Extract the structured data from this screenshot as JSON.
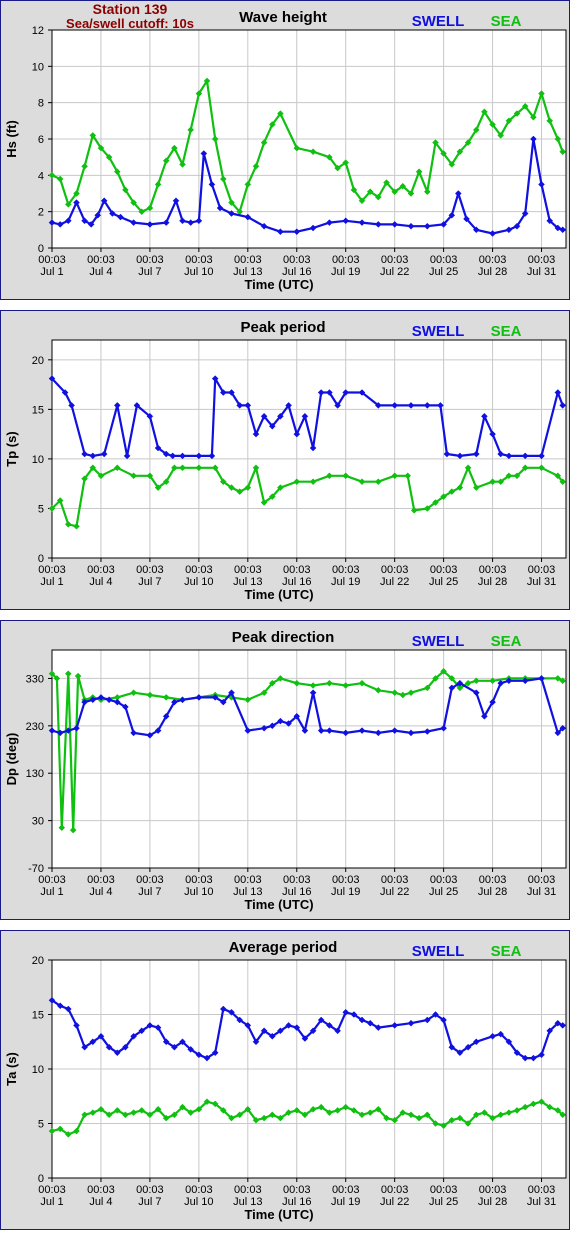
{
  "header": {
    "station": "Station 139",
    "cutoff": "Sea/swell cutoff: 10s"
  },
  "legend": {
    "swell": "SWELL",
    "sea": "SEA"
  },
  "colors": {
    "swell": "#1010e0",
    "sea": "#10c010",
    "panel_bg": "#dcdcdc",
    "border": "#1a1a8a",
    "grid": "#c8c8c8",
    "header_text": "#8b0000"
  },
  "x_axis": {
    "label": "Time (UTC)",
    "ticks_day": [
      1,
      4,
      7,
      10,
      13,
      16,
      19,
      22,
      25,
      28,
      31
    ],
    "tick_time": "00:03",
    "tick_dates": [
      "Jul 1",
      "Jul 4",
      "Jul 7",
      "Jul 10",
      "Jul 13",
      "Jul 16",
      "Jul 19",
      "Jul 22",
      "Jul 25",
      "Jul 28",
      "Jul 31"
    ],
    "xlim": [
      1,
      32.5
    ]
  },
  "chart_data": [
    {
      "type": "line",
      "title": "Wave height",
      "ylabel": "Hs (ft)",
      "ylim": [
        0,
        12
      ],
      "yticks": [
        0,
        2,
        4,
        6,
        8,
        10,
        12
      ],
      "series": [
        {
          "name": "SWELL",
          "x": [
            1,
            1.5,
            2,
            2.5,
            3,
            3.4,
            3.8,
            4.2,
            4.7,
            5.2,
            6,
            7,
            8,
            8.6,
            9,
            9.5,
            10,
            10.3,
            10.8,
            11.3,
            12,
            13,
            14,
            15,
            16,
            17,
            18,
            19,
            20,
            21,
            22,
            23,
            24,
            25,
            25.5,
            25.9,
            26.4,
            27,
            28,
            29,
            29.5,
            30,
            30.5,
            31,
            31.5,
            32,
            32.3
          ],
          "values": [
            1.4,
            1.3,
            1.5,
            2.5,
            1.5,
            1.3,
            1.8,
            2.6,
            1.9,
            1.7,
            1.4,
            1.3,
            1.4,
            2.6,
            1.5,
            1.4,
            1.5,
            5.2,
            3.5,
            2.2,
            1.9,
            1.7,
            1.2,
            0.9,
            0.9,
            1.1,
            1.4,
            1.5,
            1.4,
            1.3,
            1.3,
            1.2,
            1.2,
            1.3,
            1.8,
            3.0,
            1.6,
            1.0,
            0.8,
            1.0,
            1.2,
            1.9,
            6.0,
            3.5,
            1.5,
            1.1,
            1.0
          ]
        },
        {
          "name": "SEA",
          "x": [
            1,
            1.5,
            2,
            2.5,
            3,
            3.5,
            4,
            4.5,
            5,
            5.5,
            6,
            6.5,
            7,
            7.5,
            8,
            8.5,
            9,
            9.5,
            10,
            10.5,
            11,
            11.5,
            12,
            12.5,
            13,
            13.5,
            14,
            14.5,
            15,
            16,
            17,
            18,
            18.5,
            19,
            19.5,
            20,
            20.5,
            21,
            21.5,
            22,
            22.5,
            23,
            23.5,
            24,
            24.5,
            25,
            25.5,
            26,
            26.5,
            27,
            27.5,
            28,
            28.5,
            29,
            29.5,
            30,
            30.5,
            31,
            31.5,
            32,
            32.3
          ],
          "values": [
            4.0,
            3.8,
            2.4,
            3.0,
            4.5,
            6.2,
            5.5,
            5.0,
            4.2,
            3.2,
            2.5,
            2.0,
            2.2,
            3.5,
            4.8,
            5.5,
            4.6,
            6.5,
            8.5,
            9.2,
            6.0,
            3.8,
            2.5,
            2.0,
            3.5,
            4.5,
            5.8,
            6.8,
            7.4,
            5.5,
            5.3,
            5.0,
            4.4,
            4.7,
            3.2,
            2.6,
            3.1,
            2.8,
            3.6,
            3.1,
            3.4,
            3.0,
            4.2,
            3.1,
            5.8,
            5.2,
            4.6,
            5.3,
            5.8,
            6.5,
            7.5,
            6.8,
            6.2,
            7.0,
            7.4,
            7.8,
            7.2,
            8.5,
            7.0,
            6.0,
            5.3
          ]
        }
      ]
    },
    {
      "type": "line",
      "title": "Peak period",
      "ylabel": "Tp (s)",
      "ylim": [
        0,
        22
      ],
      "yticks": [
        0,
        5,
        10,
        15,
        20
      ],
      "series": [
        {
          "name": "SWELL",
          "x": [
            1,
            1.8,
            2.2,
            3,
            3.5,
            4.2,
            5,
            5.6,
            6.2,
            7,
            7.5,
            8,
            8.4,
            9,
            10,
            10.8,
            11,
            11.5,
            12,
            12.5,
            13,
            13.5,
            14,
            14.5,
            15,
            15.5,
            16,
            16.5,
            17,
            17.5,
            18,
            18.5,
            19,
            20,
            21,
            22,
            23,
            24,
            24.8,
            25.2,
            26,
            27,
            27.5,
            28,
            28.5,
            29,
            30,
            31,
            32,
            32.3
          ],
          "values": [
            18.1,
            16.7,
            15.4,
            10.5,
            10.3,
            10.5,
            15.4,
            10.3,
            15.4,
            14.3,
            11.1,
            10.5,
            10.3,
            10.3,
            10.3,
            10.3,
            18.1,
            16.7,
            16.7,
            15.4,
            15.4,
            12.5,
            14.3,
            13.3,
            14.3,
            15.4,
            12.5,
            14.3,
            11.1,
            16.7,
            16.7,
            15.4,
            16.7,
            16.7,
            15.4,
            15.4,
            15.4,
            15.4,
            15.4,
            10.5,
            10.3,
            10.5,
            14.3,
            12.5,
            10.5,
            10.3,
            10.3,
            10.3,
            16.7,
            15.4
          ]
        },
        {
          "name": "SEA",
          "x": [
            1,
            1.5,
            2,
            2.5,
            3,
            3.5,
            4,
            5,
            6,
            7,
            7.5,
            8,
            8.5,
            9,
            10,
            11,
            11.5,
            12,
            12.5,
            13,
            13.5,
            14,
            14.5,
            15,
            16,
            17,
            18,
            19,
            20,
            21,
            22,
            22.8,
            23.2,
            24,
            24.5,
            25,
            25.5,
            26,
            26.5,
            27,
            28,
            28.5,
            29,
            29.5,
            30,
            31,
            32,
            32.3
          ],
          "values": [
            5.0,
            5.8,
            3.4,
            3.2,
            8.0,
            9.1,
            8.3,
            9.1,
            8.3,
            8.3,
            7.1,
            7.7,
            9.1,
            9.1,
            9.1,
            9.1,
            7.7,
            7.1,
            6.7,
            7.1,
            9.1,
            5.6,
            6.2,
            7.1,
            7.7,
            7.7,
            8.3,
            8.3,
            7.7,
            7.7,
            8.3,
            8.3,
            4.8,
            5.0,
            5.6,
            6.2,
            6.7,
            7.1,
            9.1,
            7.1,
            7.7,
            7.7,
            8.3,
            8.3,
            9.1,
            9.1,
            8.3,
            7.7
          ]
        }
      ]
    },
    {
      "type": "line",
      "title": "Peak direction",
      "ylabel": "Dp (deg)",
      "ylim": [
        -70,
        390
      ],
      "yticks": [
        -70,
        30,
        130,
        230,
        330
      ],
      "series": [
        {
          "name": "SWELL",
          "x": [
            1,
            1.5,
            2,
            2.5,
            3,
            3.5,
            4,
            4.5,
            5,
            5.5,
            6,
            7,
            7.5,
            8,
            8.5,
            9,
            10,
            11,
            11.5,
            12,
            13,
            14,
            14.5,
            15,
            15.5,
            16,
            16.5,
            17,
            17.5,
            18,
            19,
            20,
            21,
            22,
            23,
            24,
            25,
            25.5,
            26,
            27,
            27.5,
            28,
            28.5,
            29,
            30,
            31,
            32,
            32.3
          ],
          "values": [
            220,
            215,
            220,
            225,
            280,
            285,
            290,
            285,
            280,
            270,
            215,
            210,
            220,
            250,
            280,
            285,
            290,
            290,
            280,
            300,
            220,
            225,
            230,
            240,
            235,
            250,
            220,
            300,
            220,
            220,
            215,
            220,
            215,
            220,
            215,
            218,
            225,
            310,
            320,
            300,
            250,
            280,
            320,
            325,
            325,
            330,
            215,
            225
          ]
        },
        {
          "name": "SEA",
          "x": [
            1,
            1.3,
            1.6,
            2,
            2.3,
            2.6,
            3,
            3.5,
            4,
            5,
            6,
            7,
            8,
            9,
            10,
            11,
            12,
            13,
            14,
            14.5,
            15,
            16,
            17,
            18,
            19,
            20,
            21,
            22,
            22.5,
            23,
            24,
            24.5,
            25,
            25.5,
            26,
            26.5,
            27,
            28,
            29,
            30,
            31,
            32,
            32.3
          ],
          "values": [
            340,
            330,
            15,
            340,
            10,
            335,
            285,
            290,
            285,
            290,
            300,
            295,
            290,
            285,
            290,
            295,
            290,
            285,
            300,
            320,
            330,
            320,
            315,
            320,
            315,
            320,
            305,
            300,
            295,
            300,
            310,
            330,
            345,
            330,
            310,
            320,
            325,
            325,
            330,
            330,
            330,
            330,
            325
          ]
        }
      ]
    },
    {
      "type": "line",
      "title": "Average period",
      "ylabel": "Ta (s)",
      "ylim": [
        0,
        20
      ],
      "yticks": [
        0,
        5,
        10,
        15,
        20
      ],
      "series": [
        {
          "name": "SWELL",
          "x": [
            1,
            1.5,
            2,
            2.5,
            3,
            3.5,
            4,
            4.5,
            5,
            5.5,
            6,
            6.5,
            7,
            7.5,
            8,
            8.5,
            9,
            9.5,
            10,
            10.5,
            11,
            11.5,
            12,
            12.5,
            13,
            13.5,
            14,
            14.5,
            15,
            15.5,
            16,
            16.5,
            17,
            17.5,
            18,
            18.5,
            19,
            19.5,
            20,
            20.5,
            21,
            22,
            23,
            24,
            24.5,
            25,
            25.5,
            26,
            26.5,
            27,
            28,
            28.5,
            29,
            29.5,
            30,
            30.5,
            31,
            31.5,
            32,
            32.3
          ],
          "values": [
            16.3,
            15.8,
            15.5,
            14.0,
            12.0,
            12.5,
            13.0,
            12.0,
            11.5,
            12.0,
            13.0,
            13.5,
            14.0,
            13.8,
            12.5,
            12.0,
            12.5,
            11.8,
            11.3,
            11.0,
            11.5,
            15.5,
            15.2,
            14.5,
            14.0,
            12.5,
            13.5,
            13.0,
            13.5,
            14.0,
            13.8,
            12.8,
            13.5,
            14.5,
            14.0,
            13.5,
            15.2,
            15.0,
            14.5,
            14.2,
            13.8,
            14.0,
            14.2,
            14.5,
            15.0,
            14.5,
            12.0,
            11.5,
            12.0,
            12.5,
            13.0,
            13.2,
            12.5,
            11.5,
            11.0,
            11.0,
            11.3,
            13.5,
            14.2,
            14.0
          ]
        },
        {
          "name": "SEA",
          "x": [
            1,
            1.5,
            2,
            2.5,
            3,
            3.5,
            4,
            4.5,
            5,
            5.5,
            6,
            6.5,
            7,
            7.5,
            8,
            8.5,
            9,
            9.5,
            10,
            10.5,
            11,
            11.5,
            12,
            12.5,
            13,
            13.5,
            14,
            14.5,
            15,
            15.5,
            16,
            16.5,
            17,
            17.5,
            18,
            18.5,
            19,
            19.5,
            20,
            20.5,
            21,
            21.5,
            22,
            22.5,
            23,
            23.5,
            24,
            24.5,
            25,
            25.5,
            26,
            26.5,
            27,
            27.5,
            28,
            28.5,
            29,
            29.5,
            30,
            30.5,
            31,
            31.5,
            32,
            32.3
          ],
          "values": [
            4.3,
            4.5,
            4.0,
            4.3,
            5.8,
            6.0,
            6.3,
            5.8,
            6.2,
            5.8,
            6.0,
            6.2,
            5.8,
            6.3,
            5.5,
            5.8,
            6.5,
            6.0,
            6.3,
            7.0,
            6.8,
            6.2,
            5.5,
            5.8,
            6.3,
            5.3,
            5.5,
            5.8,
            5.5,
            6.0,
            6.2,
            5.8,
            6.3,
            6.5,
            6.0,
            6.2,
            6.5,
            6.2,
            5.8,
            6.0,
            6.3,
            5.5,
            5.3,
            6.0,
            5.8,
            5.5,
            5.8,
            5.0,
            4.8,
            5.3,
            5.5,
            5.0,
            5.8,
            6.0,
            5.5,
            5.8,
            6.0,
            6.2,
            6.5,
            6.8,
            7.0,
            6.5,
            6.2,
            5.8
          ]
        }
      ]
    }
  ]
}
